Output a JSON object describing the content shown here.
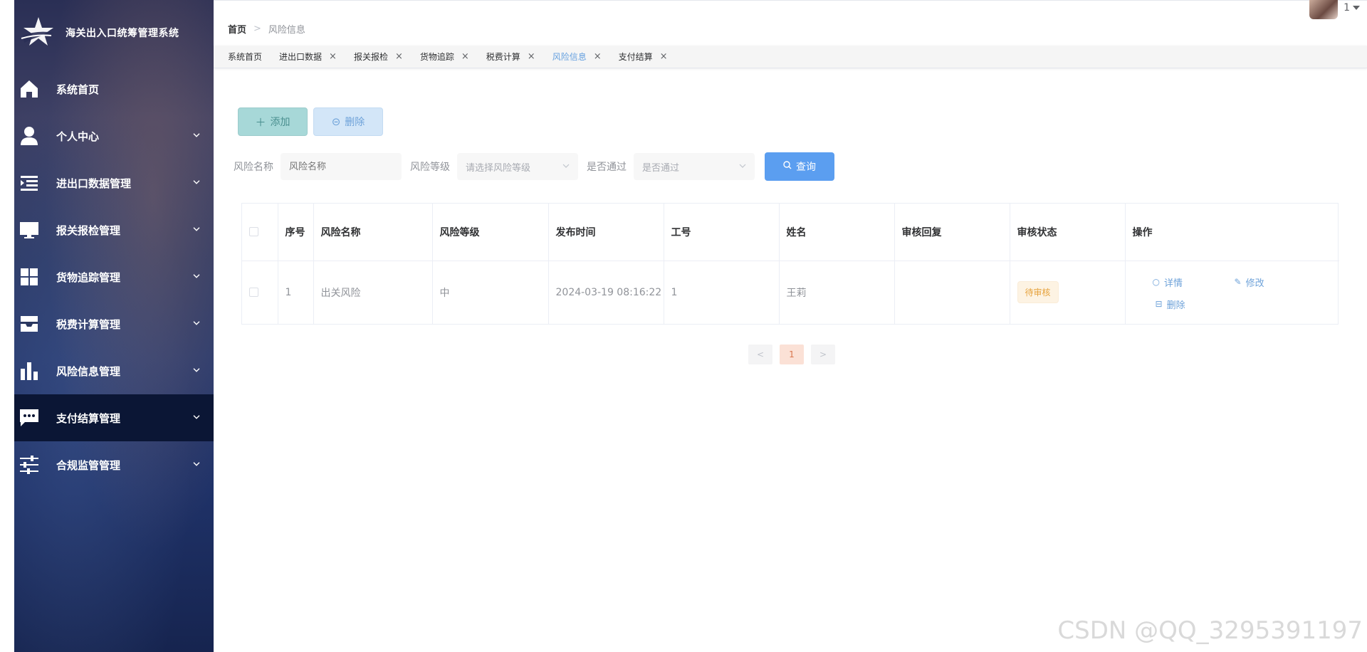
{
  "app": {
    "title": "海关出入口统筹管理系统"
  },
  "sidebar": {
    "items": [
      {
        "label": "系统首页",
        "icon": "home-icon",
        "has_arrow": false
      },
      {
        "label": "个人中心",
        "icon": "person-icon",
        "has_arrow": true
      },
      {
        "label": "进出口数据管理",
        "icon": "list-indent-icon",
        "has_arrow": true
      },
      {
        "label": "报关报检管理",
        "icon": "monitor-icon",
        "has_arrow": true
      },
      {
        "label": "货物追踪管理",
        "icon": "grid-icon",
        "has_arrow": true
      },
      {
        "label": "税费计算管理",
        "icon": "inbox-icon",
        "has_arrow": true
      },
      {
        "label": "风险信息管理",
        "icon": "bar-chart-icon",
        "has_arrow": true
      },
      {
        "label": "支付结算管理",
        "icon": "chat-icon",
        "has_arrow": true,
        "active": true
      },
      {
        "label": "合规监管管理",
        "icon": "sliders-icon",
        "has_arrow": true
      }
    ]
  },
  "header": {
    "breadcrumb": {
      "home": "首页",
      "separator": ">",
      "current": "风险信息"
    },
    "user": {
      "name": "1"
    }
  },
  "tags": [
    {
      "label": "系统首页",
      "closable": false
    },
    {
      "label": "进出口数据",
      "closable": true
    },
    {
      "label": "报关报检",
      "closable": true
    },
    {
      "label": "货物追踪",
      "closable": true
    },
    {
      "label": "税费计算",
      "closable": true
    },
    {
      "label": "风险信息",
      "closable": true,
      "active": true
    },
    {
      "label": "支付结算",
      "closable": true
    }
  ],
  "toolbar": {
    "add_label": "添加",
    "delete_label": "删除"
  },
  "filters": {
    "risk_name_label": "风险名称",
    "risk_name_placeholder": "风险名称",
    "risk_level_label": "风险等级",
    "risk_level_placeholder": "请选择风险等级",
    "passed_label": "是否通过",
    "passed_placeholder": "是否通过",
    "query_label": "查询"
  },
  "table": {
    "columns": [
      "序号",
      "风险名称",
      "风险等级",
      "发布时间",
      "工号",
      "姓名",
      "审核回复",
      "审核状态",
      "操作"
    ],
    "rows": [
      {
        "index": "1",
        "risk_name": "出关风险",
        "risk_level": "中",
        "publish_time": "2024-03-19 08:16:22",
        "job_no": "1",
        "name": "王莉",
        "reply": "",
        "status": "待审核"
      }
    ],
    "actions": {
      "detail": "详情",
      "edit": "修改",
      "delete": "删除"
    }
  },
  "pagination": {
    "prev": "<",
    "current": "1",
    "next": ">"
  },
  "watermark": "CSDN @QQ_3295391197",
  "colors": {
    "accent": "#5b9ef0",
    "sidebar_active": "#0b1635",
    "status_pending": "#e6a23c"
  }
}
